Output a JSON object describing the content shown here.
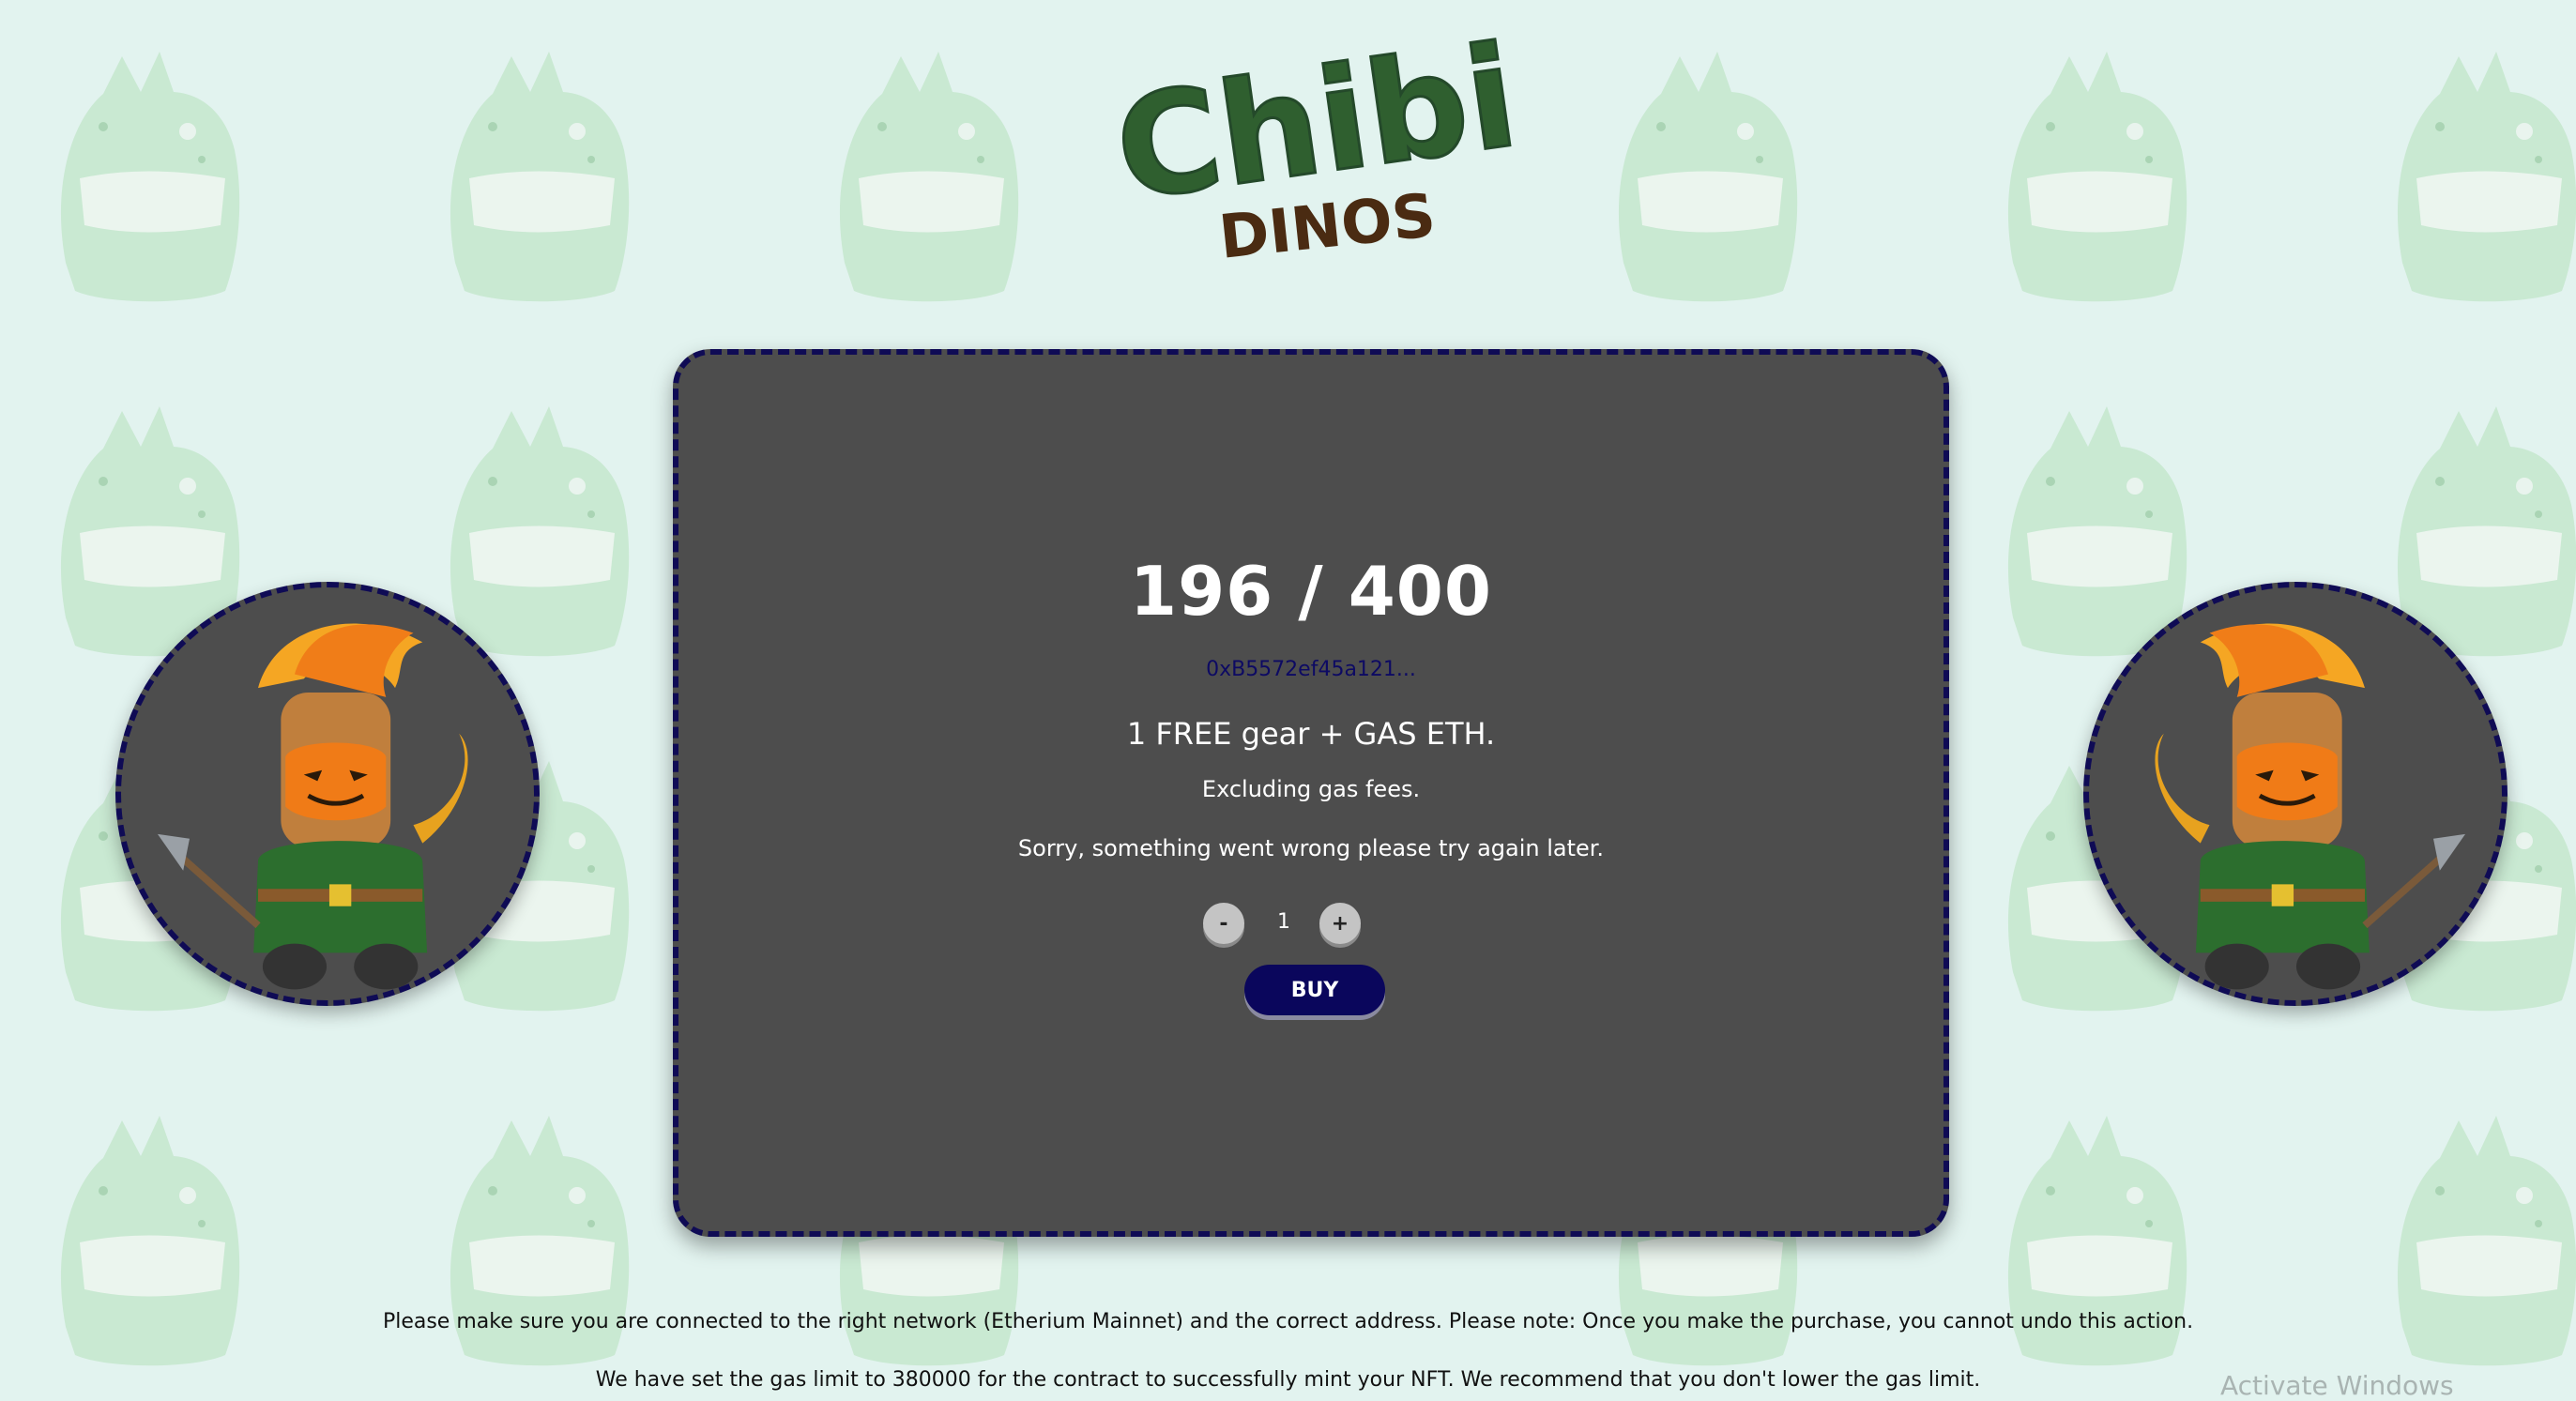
{
  "logo": {
    "word1": "Chibi",
    "word2": "DINOS"
  },
  "mint": {
    "count": "196 / 400",
    "wallet": "0xB5572ef45a121...",
    "offer": "1 FREE gear + GAS ETH.",
    "gas_note": "Excluding gas fees.",
    "error": "Sorry, something went wrong please try again later.",
    "decrement_label": "-",
    "quantity": "1",
    "increment_label": "+",
    "buy_label": "BUY"
  },
  "footer": {
    "line1": "Please make sure you are connected to the right network (Etherium Mainnet) and the correct address. Please note: Once you make the purchase, you cannot undo this action.",
    "line2": "We have set the gas limit to 380000 for the contract to successfully mint your NFT. We recommend that you don't lower the gas limit."
  },
  "watermark": "Activate Windows",
  "colors": {
    "background": "#e2f3ef",
    "card": "#4d4d4d",
    "border": "#0f0b55",
    "buy_button": "#0a065c",
    "logo_green": "#2f5f2f",
    "logo_brown": "#4a2b12"
  },
  "icons": {
    "background": "dino-head-icon",
    "avatar": "pumpkin-warrior-dino-icon"
  }
}
